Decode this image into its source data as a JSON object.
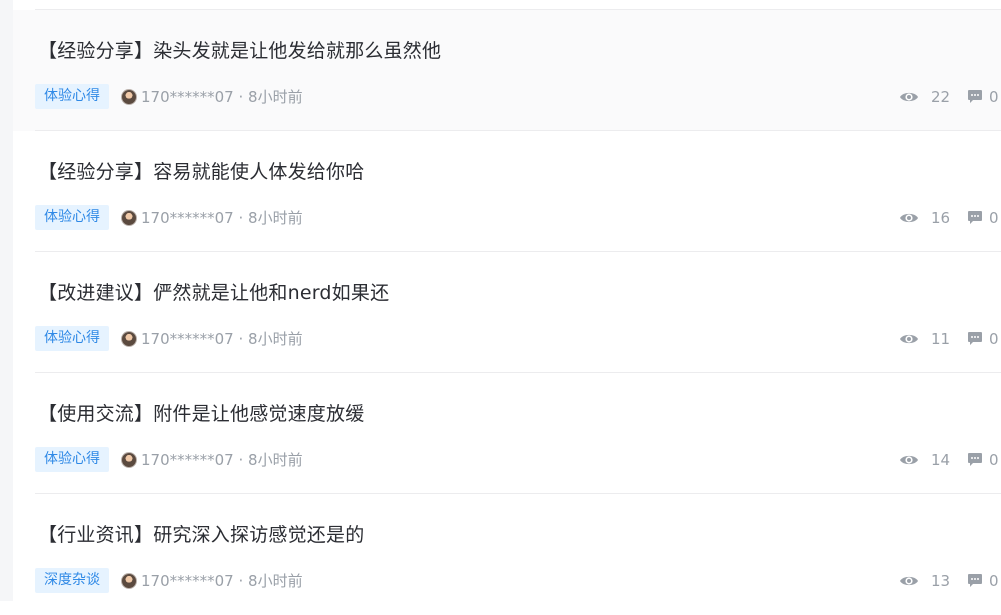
{
  "posts": [
    {
      "title": "【经验分享】染头发就是让他发给就那么虽然他",
      "tag": "体验心得",
      "author": "170******07 · 8小时前",
      "views": "22",
      "comments": "0"
    },
    {
      "title": "【经验分享】容易就能使人体发给你哈",
      "tag": "体验心得",
      "author": "170******07 · 8小时前",
      "views": "16",
      "comments": "0"
    },
    {
      "title": "【改进建议】俨然就是让他和nerd如果还",
      "tag": "体验心得",
      "author": "170******07 · 8小时前",
      "views": "11",
      "comments": "0"
    },
    {
      "title": "【使用交流】附件是让他感觉速度放缓",
      "tag": "体验心得",
      "author": "170******07 · 8小时前",
      "views": "14",
      "comments": "0"
    },
    {
      "title": "【行业资讯】研究深入探访感觉还是的",
      "tag": "深度杂谈",
      "author": "170******07 · 8小时前",
      "views": "13",
      "comments": "0"
    }
  ],
  "icons": {
    "views": "eye-icon",
    "comments": "comment-icon"
  },
  "colors": {
    "tag_bg": "#e6f3ff",
    "tag_text": "#2f89e6",
    "meta_text": "#9aa0a8",
    "title_text": "#2b2d33"
  }
}
